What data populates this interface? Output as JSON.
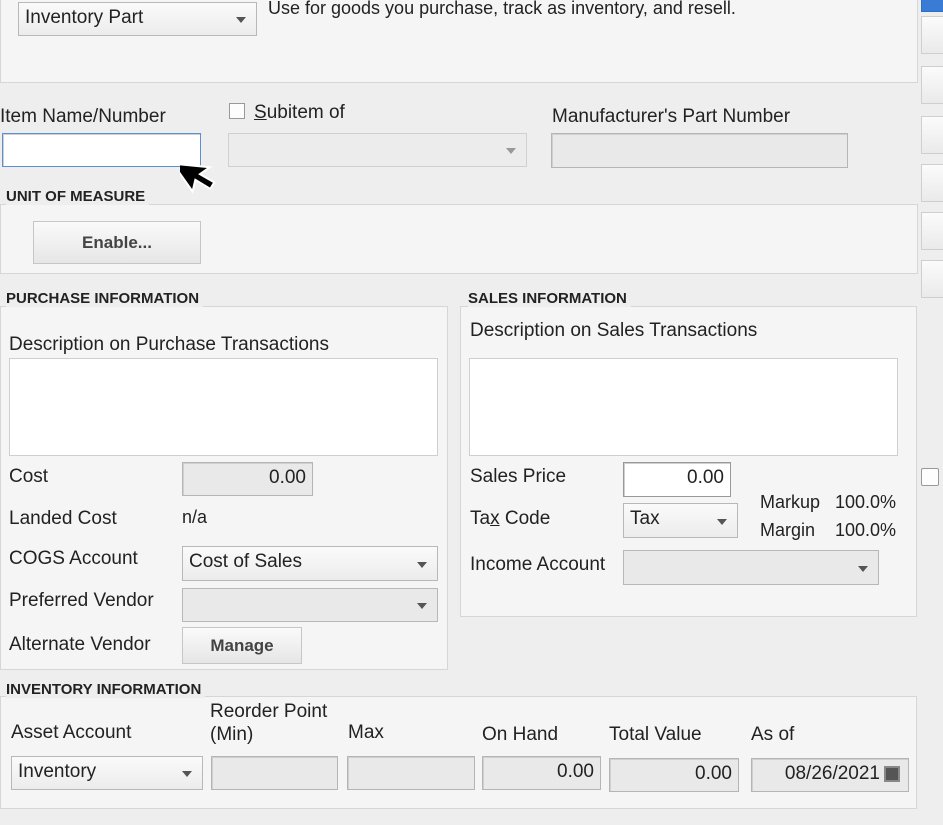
{
  "type_section": {
    "type_value": "Inventory Part",
    "type_description": "Use for goods you purchase, track as inventory, and resell."
  },
  "item_fields": {
    "item_name_label": "Item Name/Number",
    "item_name_value": "",
    "subitem_label": "Subitem of",
    "subitem_underline": "S",
    "subitem_rest": "ubitem of",
    "manufacturer_label": "Manufacturer's Part Number",
    "manufacturer_value": ""
  },
  "unit_of_measure": {
    "heading": "UNIT OF MEASURE",
    "enable_label": "Enable..."
  },
  "purchase": {
    "heading": "PURCHASE INFORMATION",
    "description_label": "Description on Purchase Transactions",
    "description_value": "",
    "cost_label": "Cost",
    "cost_value": "0.00",
    "landed_cost_label": "Landed Cost",
    "landed_cost_value": "n/a",
    "cogs_label": "COGS Account",
    "cogs_value": "Cost of Sales",
    "preferred_vendor_label": "Preferred Vendor",
    "preferred_vendor_value": "",
    "alternate_vendor_label": "Alternate Vendor",
    "manage_label": "Manage"
  },
  "sales": {
    "heading": "SALES INFORMATION",
    "description_label": "Description on Sales Transactions",
    "description_value": "",
    "sales_price_label": "Sales Price",
    "sales_price_value": "0.00",
    "tax_code_label_pre": "Ta",
    "tax_code_label_underline": "x",
    "tax_code_label_post": " Code",
    "tax_code_value": "Tax",
    "markup_label": "Markup",
    "markup_value": "100.0%",
    "margin_label": "Margin",
    "margin_value": "100.0%",
    "income_account_label": "Income Account",
    "income_account_value": ""
  },
  "inventory": {
    "heading": "INVENTORY INFORMATION",
    "asset_account_label": "Asset Account",
    "asset_account_value": "Inventory",
    "reorder_label_line1": "Reorder Point",
    "reorder_label_line2": "(Min)",
    "reorder_value": "",
    "max_label": "Max",
    "max_value": "",
    "on_hand_label": "On Hand",
    "on_hand_value": "0.00",
    "total_value_label": "Total Value",
    "total_value_value": "0.00",
    "as_of_label": "As of",
    "as_of_value": "08/26/2021"
  },
  "icons": {
    "cursor": "mouse-pointer-icon",
    "calendar": "calendar-icon",
    "dropdown": "chevron-down-icon"
  },
  "colors": {
    "background": "#eeeeee",
    "panel": "#f5f5f5",
    "field": "#e9e9e9",
    "accent": "#2f6fc7"
  }
}
